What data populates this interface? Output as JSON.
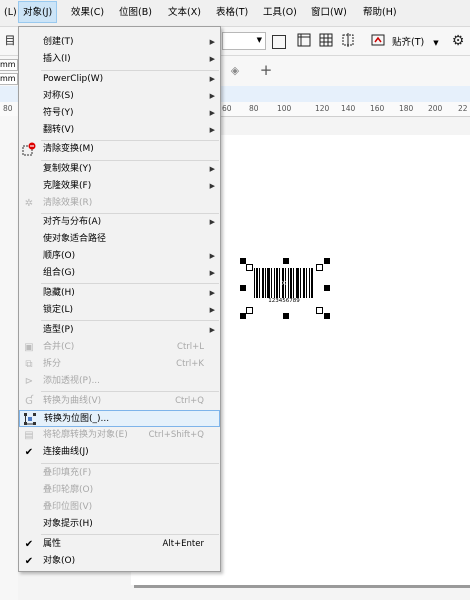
{
  "menubar": {
    "items": [
      {
        "label": "(L)"
      },
      {
        "label": "对象(J)"
      },
      {
        "label": "效果(C)"
      },
      {
        "label": "位图(B)"
      },
      {
        "label": "文本(X)"
      },
      {
        "label": "表格(T)"
      },
      {
        "label": "工具(O)"
      },
      {
        "label": "窗口(W)"
      },
      {
        "label": "帮助(H)"
      }
    ]
  },
  "toolbar": {
    "snap_label": "贴齐(T)",
    "left_glyph": "目"
  },
  "propbar": {
    "unit1": "mm",
    "unit2": "mm",
    "add_glyph": "+"
  },
  "ruler": {
    "ticks": [
      "80",
      "60",
      "80",
      "100",
      "120",
      "140",
      "160",
      "180",
      "200",
      "22"
    ]
  },
  "barcode": {
    "number": "123456789"
  },
  "menu": {
    "items": [
      {
        "label": "创建(T)",
        "arrow": "▶"
      },
      {
        "label": "插入(I)",
        "arrow": "▶"
      },
      {
        "label": "PowerClip(W)",
        "arrow": "▶"
      },
      {
        "label": "对称(S)",
        "arrow": "▶"
      },
      {
        "label": "符号(Y)",
        "arrow": "▶"
      },
      {
        "label": "翻转(V)",
        "arrow": "▶"
      },
      {
        "label": "清除变换(M)"
      },
      {
        "label": "复制效果(Y)",
        "arrow": "▶"
      },
      {
        "label": "克隆效果(F)",
        "arrow": "▶"
      },
      {
        "label": "清除效果(R)"
      },
      {
        "label": "对齐与分布(A)",
        "arrow": "▶"
      },
      {
        "label": "使对象适合路径"
      },
      {
        "label": "顺序(O)",
        "arrow": "▶"
      },
      {
        "label": "组合(G)",
        "arrow": "▶"
      },
      {
        "label": "隐藏(H)",
        "arrow": "▶"
      },
      {
        "label": "锁定(L)",
        "arrow": "▶"
      },
      {
        "label": "造型(P)",
        "arrow": "▶"
      },
      {
        "label": "合并(C)",
        "shortcut": "Ctrl+L"
      },
      {
        "label": "拆分",
        "shortcut": "Ctrl+K"
      },
      {
        "label": "添加透视(P)..."
      },
      {
        "label": "转换为曲线(V)",
        "shortcut": "Ctrl+Q"
      },
      {
        "label": "转换为位图(_)..."
      },
      {
        "label": "将轮廓转换为对象(E)",
        "shortcut": "Ctrl+Shift+Q"
      },
      {
        "label": "连接曲线(J)"
      },
      {
        "label": "叠印填充(F)"
      },
      {
        "label": "叠印轮廓(O)"
      },
      {
        "label": "叠印位图(V)"
      },
      {
        "label": "对象提示(H)"
      },
      {
        "label": "属性",
        "shortcut": "Alt+Enter"
      },
      {
        "label": "对象(O)"
      }
    ],
    "check_glyph": "✔"
  }
}
